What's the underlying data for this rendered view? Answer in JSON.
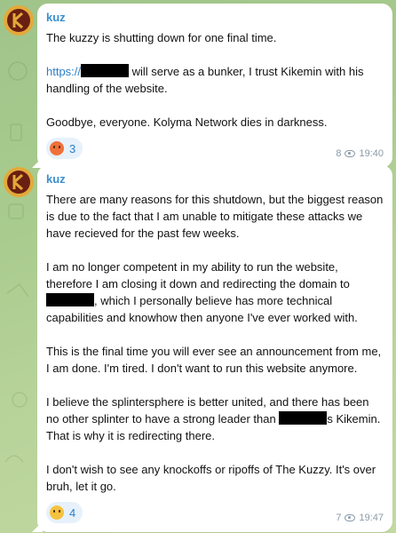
{
  "colors": {
    "sender": "#3a8fd0",
    "link": "#2a7fc8",
    "reaction_bg": "#e7f1fb"
  },
  "messages": [
    {
      "sender": "kuz",
      "para1": "The kuzzy is shutting down for one final time.",
      "para2_link": "https://",
      "para2_rest": " will serve as a bunker, I trust Kikemin with his handling of the website.",
      "para3": "Goodbye, everyone. Kolyma Network dies in darkness.",
      "reaction_icon": "angry-face-emoji",
      "reaction_count": "3",
      "views": "8",
      "time": "19:40"
    },
    {
      "sender": "kuz",
      "para1": "There are many reasons for this shutdown, but the biggest reason is due to the fact that I am unable to mitigate these attacks we have recieved for the past few weeks.",
      "para2_a": "I am no longer competent in my ability to run the website, therefore I am closing it down and redirecting the domain to ",
      "para2_b": ", which I personally believe has more technical capabilities and knowhow then anyone I've ever worked with.",
      "para3": "This is the final time you will ever see an announcement from me, I am done. I'm tired. I don't want to run this website anymore.",
      "para4_a": "I believe the splintersphere is better united, and there has been no other splinter to have a strong leader than ",
      "para4_b": "s Kikemin. That is why it is redirecting there.",
      "para5": "I don't wish to see any knockoffs or ripoffs of The Kuzzy. It's over bruh, let it go.",
      "reaction_icon": "sad-face-emoji",
      "reaction_count": "4",
      "views": "7",
      "time": "19:47"
    }
  ]
}
